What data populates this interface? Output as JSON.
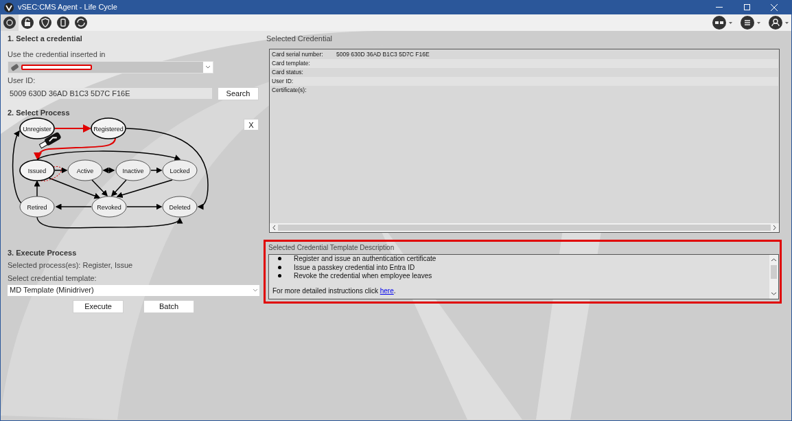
{
  "window": {
    "title": "vSEC:CMS Agent - Life Cycle"
  },
  "section1": {
    "heading": "1. Select a credential",
    "reader_label": "Use the credential inserted in",
    "user_id_label": "User ID:",
    "user_id": "5009 630D 36AD B1C3 5D7C F16E",
    "search_button": "Search"
  },
  "section2": {
    "heading": "2. Select Process",
    "close_button": "X",
    "states": [
      {
        "label": "Unregister",
        "highlighted": true
      },
      {
        "label": "Registered",
        "highlighted": true
      },
      {
        "label": "Issued",
        "highlighted": true
      },
      {
        "label": "Active",
        "highlighted": false
      },
      {
        "label": "Inactive",
        "highlighted": false
      },
      {
        "label": "Locked",
        "highlighted": false
      },
      {
        "label": "Retired",
        "highlighted": false
      },
      {
        "label": "Revoked",
        "highlighted": false
      },
      {
        "label": "Deleted",
        "highlighted": false
      }
    ]
  },
  "section3": {
    "heading": "3. Execute Process",
    "selected_processes": "Selected process(es): Register, Issue",
    "template_label": "Select credential template:",
    "template": "MD Template (Minidriver)",
    "buttons": [
      "Execute",
      "Batch"
    ]
  },
  "selected_credential": {
    "heading": "Selected Credential",
    "rows": [
      {
        "label": "Card serial number:",
        "value": "5009 630D 36AD B1C3 5D7C F16E"
      },
      {
        "label": "Card template:"
      },
      {
        "label": "Card status:"
      },
      {
        "label": "User ID:"
      },
      {
        "label": "Certificate(s):"
      }
    ]
  },
  "description": {
    "heading": "Selected Credential Template Description",
    "bullets": [
      "Register and issue an authentication certificate",
      "Issue a passkey credential into Entra ID",
      "Revoke the credential when employee leaves"
    ],
    "footer": "For more detailed instructions click ",
    "link": "here",
    "footer_end": "."
  }
}
